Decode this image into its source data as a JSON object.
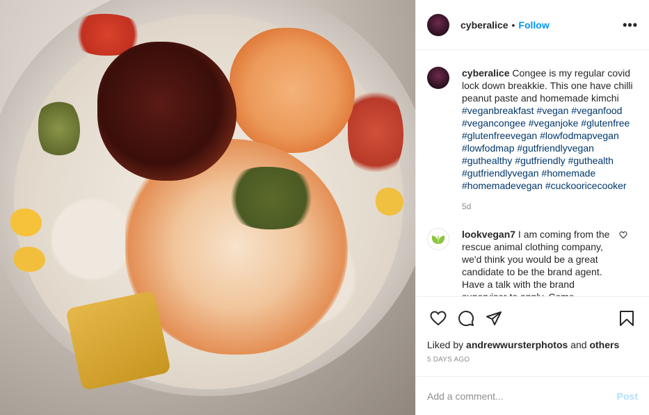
{
  "photo": {
    "icon": "food-photo"
  },
  "header": {
    "username": "cyberalice",
    "dot": "•",
    "follow_label": "Follow",
    "more_label": "•••"
  },
  "caption": {
    "username": "cyberalice",
    "text": "Congee is my regular covid lock down breakkie. This one have chilli peanut paste and homemade kimchi",
    "tags": [
      "#veganbreakfast",
      "#vegan",
      "#veganfood",
      "#vegancongee",
      "#veganjoke",
      "#glutenfree",
      "#glutenfreevegan",
      "#lowfodmapvegan",
      "#lowfodmap",
      "#gutfriendlyvegan",
      "#guthealthy",
      "#gutfriendly",
      "#guthealth",
      "#gutfriendlyvegan",
      "#homemade",
      "#homemadevegan",
      "#cuckooricecooker"
    ],
    "age": "5d"
  },
  "reply": {
    "username": "lookvegan7",
    "text": "I am coming from the rescue animal clothing company, we'd think you would be a great candidate to be the brand agent. Have a talk with the brand supervisor to apply. Come"
  },
  "likes": {
    "prefix": "Liked by",
    "user": "andrewwursterphotos",
    "and": "and",
    "others": "others"
  },
  "posted": "5 DAYS AGO",
  "add_comment": {
    "placeholder": "Add a comment...",
    "post_label": "Post"
  },
  "colors": {
    "link": "#0095f6",
    "hashtag": "#00376b",
    "muted": "#8e8e8e",
    "post_disabled": "#b2dffc"
  }
}
